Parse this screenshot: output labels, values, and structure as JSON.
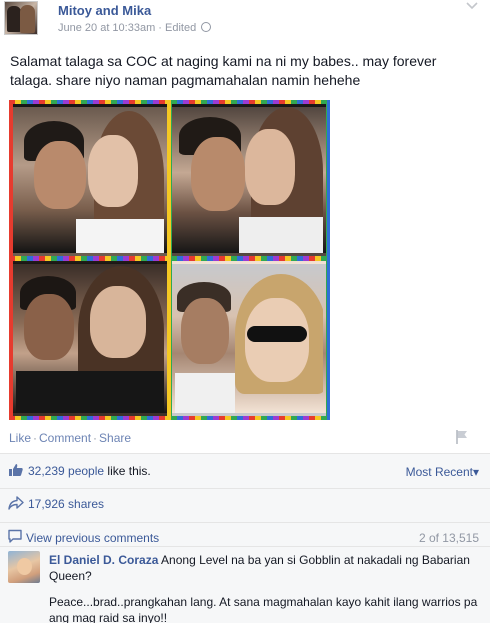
{
  "post": {
    "page_name": "Mitoy and Mika",
    "date": "June 20 at 10:33am",
    "edited_label": "Edited",
    "meta_sep": " · ",
    "text": "Salamat talaga sa COC at naging kami na ni my babes.. may forever talaga. share niyo naman pagmamahalan namin hehehe"
  },
  "actions": {
    "like": "Like",
    "comment": "Comment",
    "share": "Share",
    "sep": "·"
  },
  "summary": {
    "likes_count": "32,239 people",
    "likes_suffix": " like this.",
    "sort_label": "Most Recent",
    "sort_caret": "▾",
    "shares": "17,926 shares",
    "view_previous": "View previous comments",
    "comment_count": "2 of 13,515"
  },
  "comment": {
    "author": "El Daniel D. Coraza",
    "text1": "Anong Level na ba yan si Gobblin at nakadali ng Babarian Queen?",
    "text2": "Peace...brad..prangkahan lang. At sana magmahalan kayo kahit ilang warrios pa ang mag raid sa inyo!!"
  },
  "icons": {
    "globe": "globe-icon",
    "chevron": "chevron-down-icon",
    "flag": "flag-icon",
    "thumb": "thumbs-up-icon",
    "share": "share-arrow-icon",
    "comment": "comment-bubble-icon"
  },
  "colors": {
    "link": "#3b5998",
    "meta": "#9197a3",
    "action": "#6d84b4",
    "summary_bg": "#f6f7f8"
  }
}
